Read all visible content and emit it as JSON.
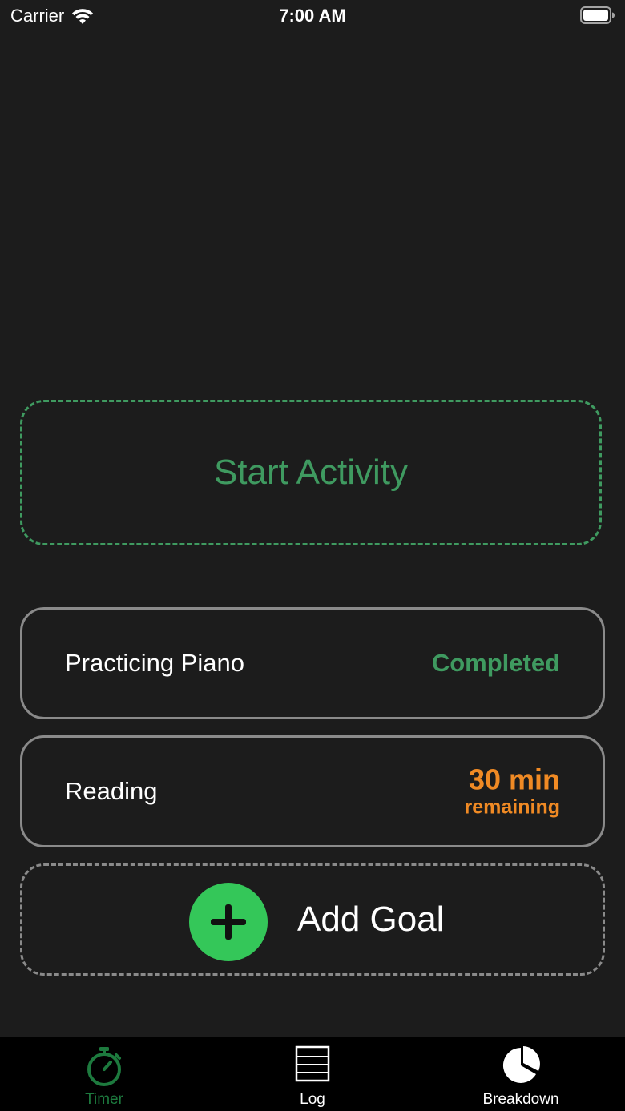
{
  "status_bar": {
    "carrier": "Carrier",
    "time": "7:00 AM",
    "icons": [
      "wifi-icon",
      "battery-icon"
    ]
  },
  "start_activity": {
    "label": "Start Activity",
    "color": "#3f9a60"
  },
  "goals": [
    {
      "name": "Practicing Piano",
      "status": "Completed",
      "status_color": "#3f9a60"
    },
    {
      "name": "Reading",
      "status_value": "30 min",
      "status_caption": "remaining",
      "status_color": "#f08a24"
    }
  ],
  "add_goal": {
    "label": "Add Goal",
    "icon": "plus-circle-icon",
    "accent": "#34c759"
  },
  "tabs": [
    {
      "label": "Timer",
      "icon": "stopwatch-icon",
      "active": true
    },
    {
      "label": "Log",
      "icon": "list-icon",
      "active": false
    },
    {
      "label": "Breakdown",
      "icon": "pie-chart-icon",
      "active": false
    }
  ],
  "colors": {
    "background": "#1c1c1c",
    "tab_bar": "#000000",
    "active_tab": "#1d7a3e"
  }
}
